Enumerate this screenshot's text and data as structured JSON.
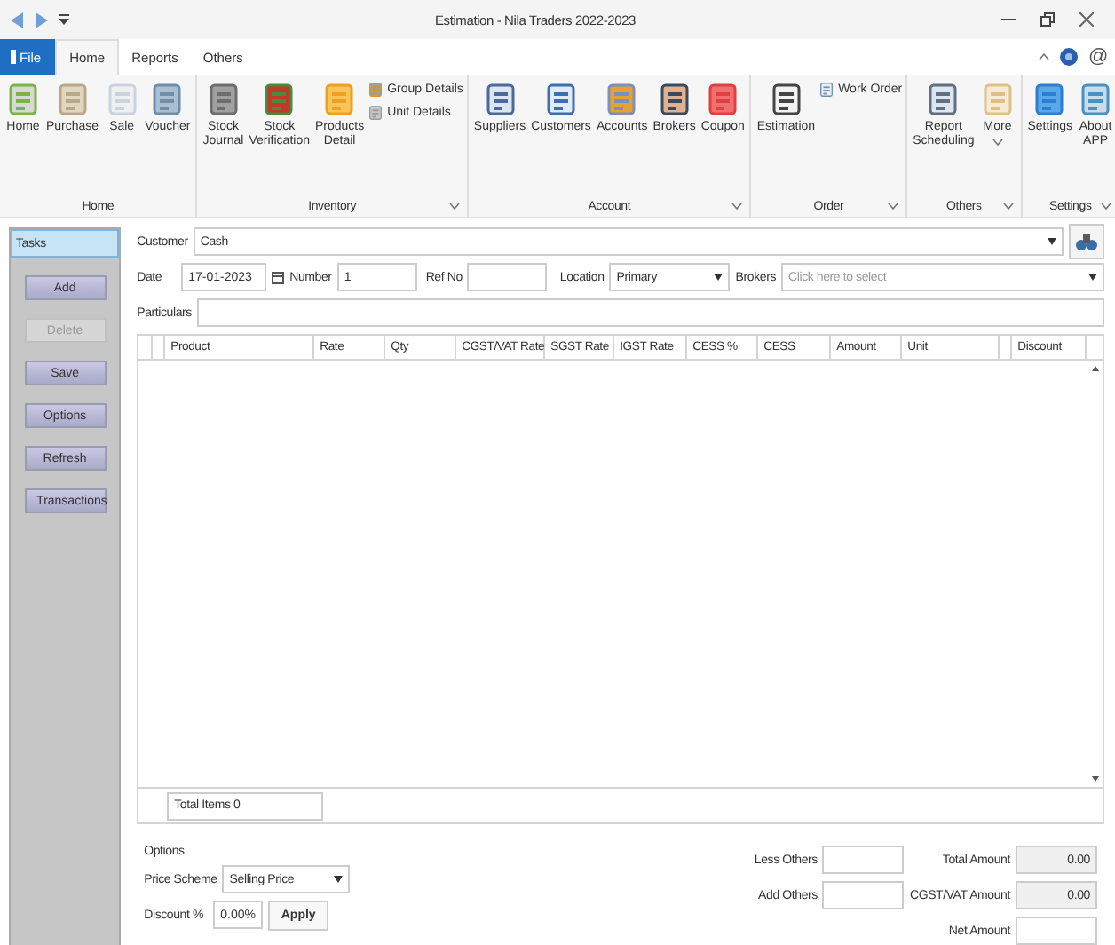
{
  "title_bar": {
    "title": "Estimation - Nila Traders 2022-2023"
  },
  "ribbon_tabs": [
    {
      "label": "File",
      "kind": "file",
      "selected": false
    },
    {
      "label": "Home",
      "kind": "tab",
      "selected": true
    },
    {
      "label": "Reports",
      "kind": "tab",
      "selected": false
    },
    {
      "label": "Others",
      "kind": "tab",
      "selected": false
    }
  ],
  "help_at": "@",
  "ribbon_groups": [
    {
      "label": "Home",
      "large_items": [
        {
          "label": "Home"
        },
        {
          "label": "Purchase"
        },
        {
          "label": "Sale"
        },
        {
          "label": "Voucher"
        }
      ]
    },
    {
      "label": "Inventory",
      "launcher": true,
      "large_items": [
        {
          "label": "Stock Journal"
        },
        {
          "label": "Stock Verification"
        },
        {
          "label": "Products Detail"
        }
      ],
      "small_items": [
        {
          "label": "Group Details"
        },
        {
          "label": "Unit Details"
        }
      ]
    },
    {
      "label": "Account",
      "launcher": true,
      "large_items": [
        {
          "label": "Suppliers"
        },
        {
          "label": "Customers"
        },
        {
          "label": "Accounts"
        },
        {
          "label": "Brokers"
        },
        {
          "label": "Coupon"
        }
      ]
    },
    {
      "label": "Order",
      "launcher": true,
      "large_items": [
        {
          "label": "Estimation"
        }
      ],
      "small_items": [
        {
          "label": "Work Order"
        }
      ]
    },
    {
      "label": "Others",
      "launcher": true,
      "large_items": [
        {
          "label": "Report Scheduling"
        },
        {
          "label": "More",
          "dropdown": true
        }
      ]
    },
    {
      "label": "Settings",
      "launcher": true,
      "large_items": [
        {
          "label": "Settings"
        },
        {
          "label": "About APP"
        }
      ]
    }
  ],
  "tasks": {
    "title": "Tasks",
    "buttons": [
      {
        "label": "Add",
        "disabled": false
      },
      {
        "label": "Delete",
        "disabled": true
      },
      {
        "label": "Save",
        "disabled": false
      },
      {
        "label": "Options",
        "disabled": false
      },
      {
        "label": "Refresh",
        "disabled": false
      },
      {
        "label": "Transactions",
        "disabled": false
      }
    ]
  },
  "form": {
    "customer": {
      "label": "Customer",
      "value": "Cash"
    },
    "date": {
      "label": "Date",
      "value": "17-01-2023"
    },
    "number": {
      "label": "Number",
      "value": "1"
    },
    "ref_no": {
      "label": "Ref No"
    },
    "location": {
      "label": "Location",
      "value": "Primary"
    },
    "brokers": {
      "label": "Brokers",
      "placeholder": "Click here to select"
    },
    "particulars": {
      "label": "Particulars"
    }
  },
  "table": {
    "columns": [
      {
        "kind": "blank"
      },
      {
        "kind": "blank"
      },
      {
        "kind": "text",
        "label": "Product"
      },
      {
        "kind": "text",
        "label": "Rate"
      },
      {
        "kind": "text",
        "label": "Qty"
      },
      {
        "kind": "text",
        "label": "CGST/VAT Rate"
      },
      {
        "kind": "text",
        "label": "SGST Rate"
      },
      {
        "kind": "text",
        "label": "IGST Rate"
      },
      {
        "kind": "text",
        "label": "CESS %"
      },
      {
        "kind": "text",
        "label": "CESS"
      },
      {
        "kind": "text",
        "label": "Amount"
      },
      {
        "kind": "text",
        "label": "Unit"
      },
      {
        "kind": "blank"
      },
      {
        "kind": "text",
        "label": "Discount"
      }
    ],
    "total_items": "Total Items 0"
  },
  "options": {
    "title": "Options",
    "price_scheme": {
      "label": "Price Scheme",
      "value": "Selling Price"
    },
    "discount": {
      "label": "Discount %",
      "value": "0.00%"
    },
    "apply": "Apply"
  },
  "totals": {
    "less_others": {
      "label": "Less Others"
    },
    "add_others": {
      "label": "Add Others"
    },
    "total_amount": {
      "label": "Total Amount",
      "value": "0.00"
    },
    "cgst_amount": {
      "label": "CGST/VAT Amount",
      "value": "0.00"
    },
    "net_amount": {
      "label": "Net Amount"
    }
  }
}
